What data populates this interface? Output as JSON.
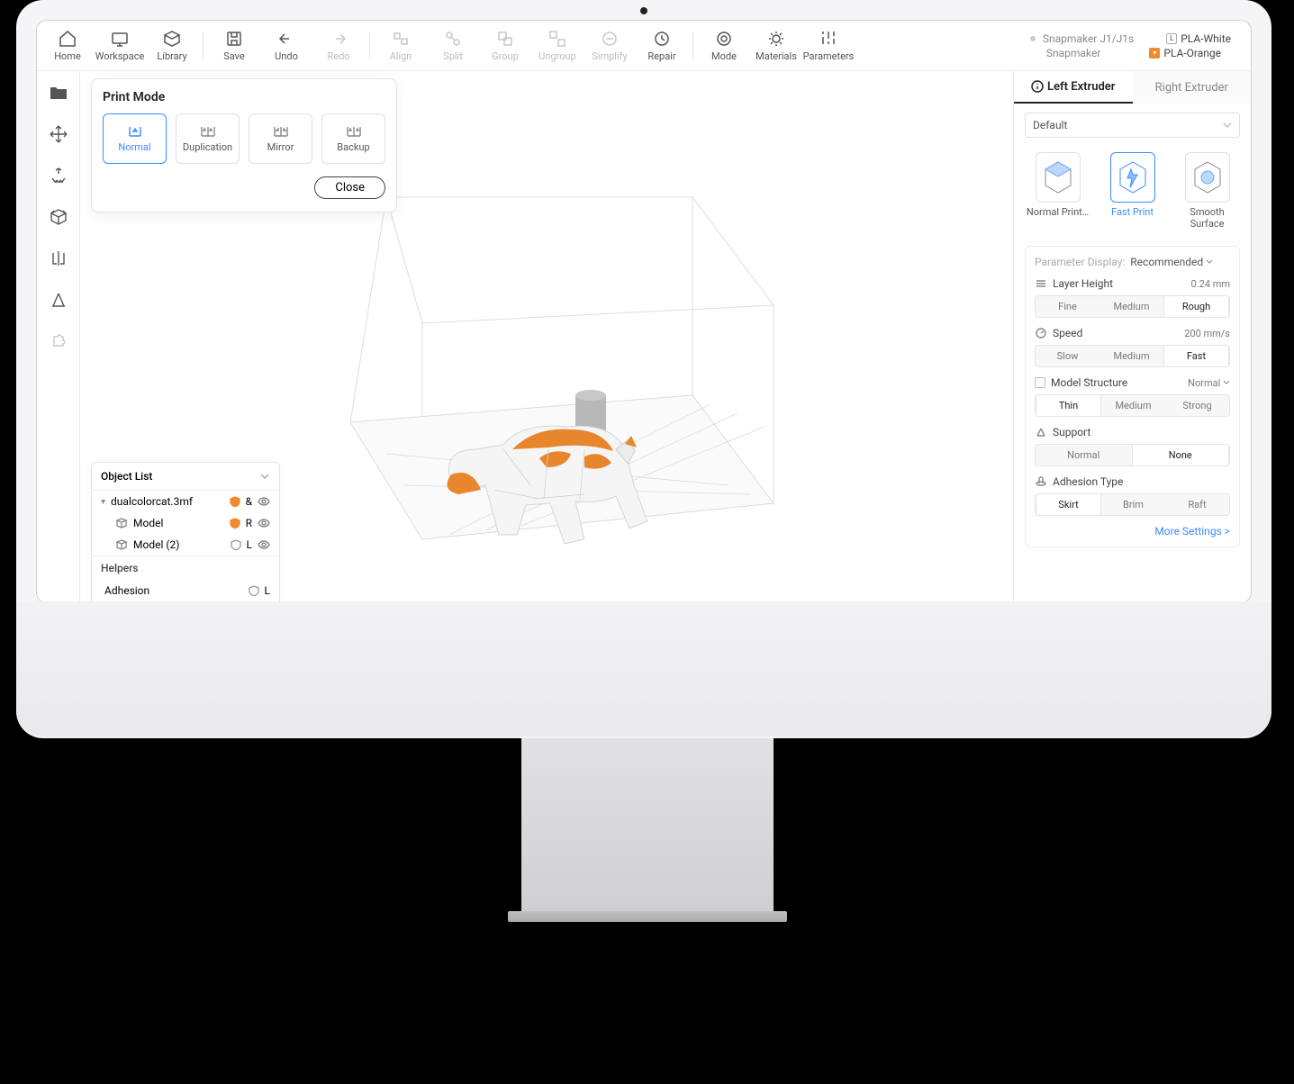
{
  "toolbar": {
    "home": "Home",
    "workspace": "Workspace",
    "library": "Library",
    "save": "Save",
    "undo": "Undo",
    "redo": "Redo",
    "align": "Align",
    "split": "Split",
    "group": "Group",
    "ungroup": "Ungroup",
    "simplify": "Simplify",
    "repair": "Repair",
    "mode": "Mode",
    "materials": "Materials",
    "parameters": "Parameters"
  },
  "device": {
    "name": "Snapmaker J1/J1s",
    "brand": "Snapmaker"
  },
  "materials": {
    "left": {
      "tag": "L",
      "name": "PLA-White"
    },
    "right": {
      "tag": "R",
      "name": "PLA-Orange"
    }
  },
  "printMode": {
    "title": "Print Mode",
    "options": [
      "Normal",
      "Duplication",
      "Mirror",
      "Backup"
    ],
    "close": "Close"
  },
  "objectList": {
    "title": "Object List",
    "file": "dualcolorcat.3mf",
    "amp": "&",
    "items": [
      {
        "name": "Model",
        "ext": "R"
      },
      {
        "name": "Model (2)",
        "ext": "L"
      }
    ],
    "helpers": "Helpers",
    "adhesion": "Adhesion",
    "adh_ext": "L"
  },
  "extruders": {
    "left": "Left Extruder",
    "right": "Right Extruder",
    "preset": "Default"
  },
  "presets": {
    "normal": "Normal Print…",
    "fast": "Fast Print",
    "smooth": "Smooth Surface"
  },
  "params": {
    "displayLabel": "Parameter Display:",
    "displayValue": "Recommended",
    "layer": {
      "label": "Layer Height",
      "value": "0.24 mm",
      "opts": [
        "Fine",
        "Medium",
        "Rough"
      ],
      "sel": 2
    },
    "speed": {
      "label": "Speed",
      "value": "200 mm/s",
      "opts": [
        "Slow",
        "Medium",
        "Fast"
      ],
      "sel": 2
    },
    "struct": {
      "label": "Model Structure",
      "value": "Normal",
      "opts": [
        "Thin",
        "Medium",
        "Strong"
      ],
      "sel": 0
    },
    "support": {
      "label": "Support",
      "opts": [
        "Normal",
        "None"
      ],
      "sel": 1
    },
    "adh": {
      "label": "Adhesion Type",
      "opts": [
        "Skirt",
        "Brim",
        "Raft"
      ],
      "sel": 0
    },
    "more": "More Settings >"
  }
}
